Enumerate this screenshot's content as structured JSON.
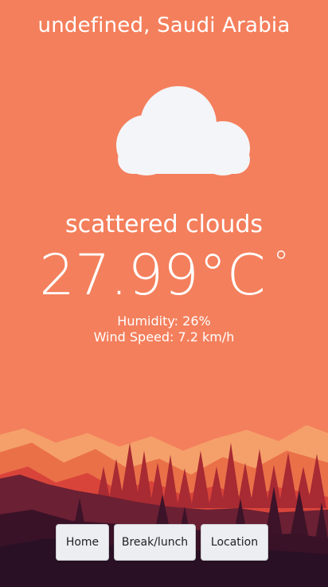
{
  "location": {
    "city": "undefined",
    "country": "Saudi Arabia",
    "label": "undefined, Saudi Arabia"
  },
  "weather": {
    "condition": "scattered clouds",
    "icon": "cloud-icon",
    "temperature": "27.99°C",
    "unit_symbol": "°",
    "humidity": "Humidity: 26%",
    "wind_speed": "Wind Speed: 7.2 km/h"
  },
  "nav": {
    "home_label": "Home",
    "break_label": "Break/lunch",
    "location_label": "Location"
  },
  "colors": {
    "sky": "#f47f5c",
    "mountain_light": "#f5a06a",
    "mountain_mid": "#e3573c",
    "forest_dark": "#5a1b2c",
    "ground": "#2a1024"
  }
}
